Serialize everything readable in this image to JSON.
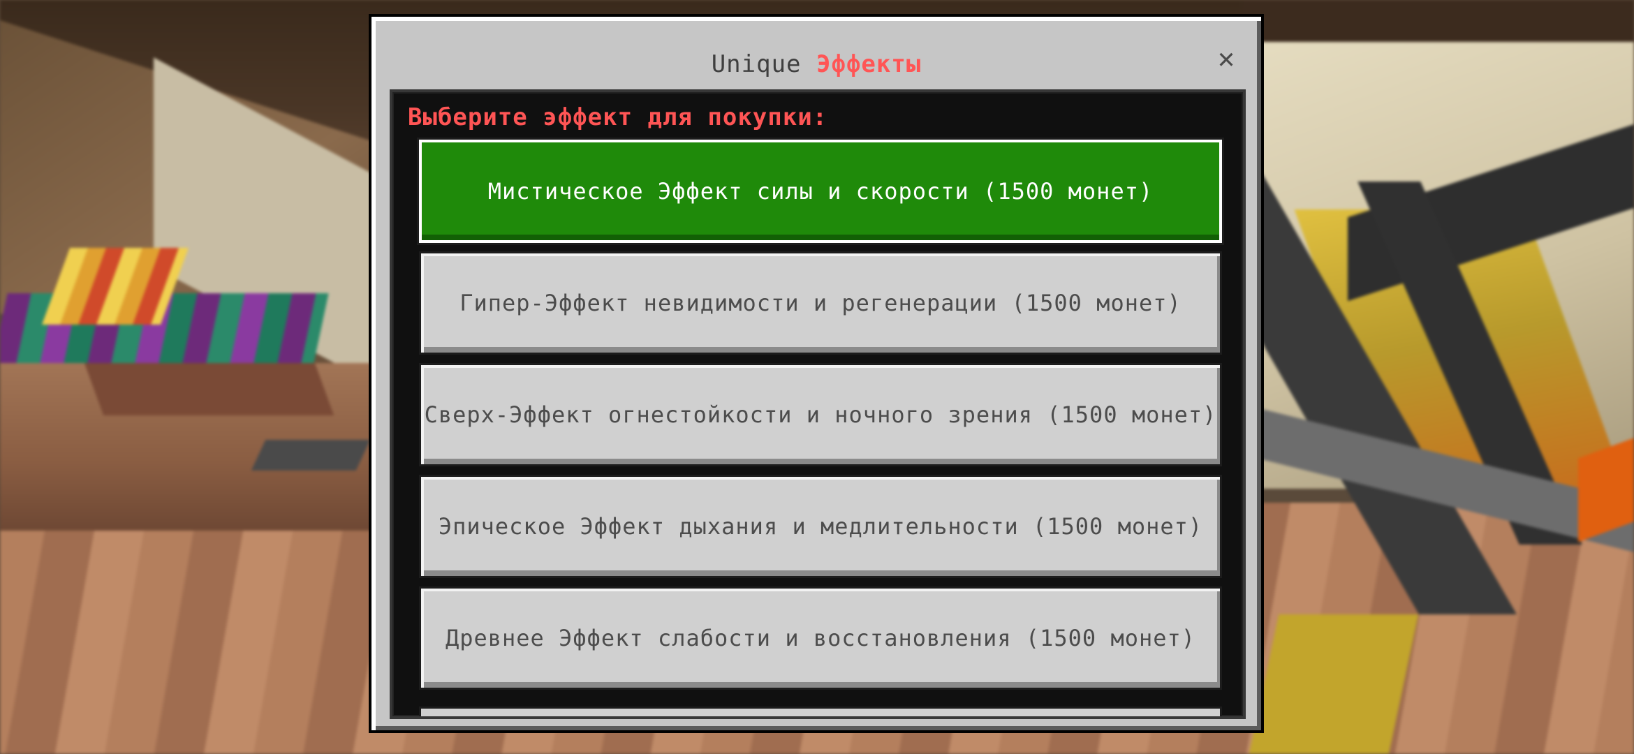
{
  "dialog": {
    "title_prefix": "Unique",
    "title_accent": "Эффекты",
    "close_glyph": "✕",
    "prompt": "Выберите эффект для покупки:"
  },
  "effects": [
    {
      "label": "Мистическое Эффект силы и скорости (1500 монет)",
      "selected": true
    },
    {
      "label": "Гипер-Эффект невидимости и регенерации (1500 монет)",
      "selected": false
    },
    {
      "label": "Сверх-Эффект огнестойкости и ночного зрения (1500 монет)",
      "selected": false
    },
    {
      "label": "Эпическое Эффект дыхания и медлительности (1500 монет)",
      "selected": false
    },
    {
      "label": "Древнее Эффект слабости и восстановления (1500 монет)",
      "selected": false
    }
  ],
  "colors": {
    "accent": "#ff5555",
    "selected_button": "#1f8a0a",
    "button": "#d0d0d0",
    "dialog": "#c6c6c6"
  },
  "icons": {
    "close": "close-icon"
  }
}
